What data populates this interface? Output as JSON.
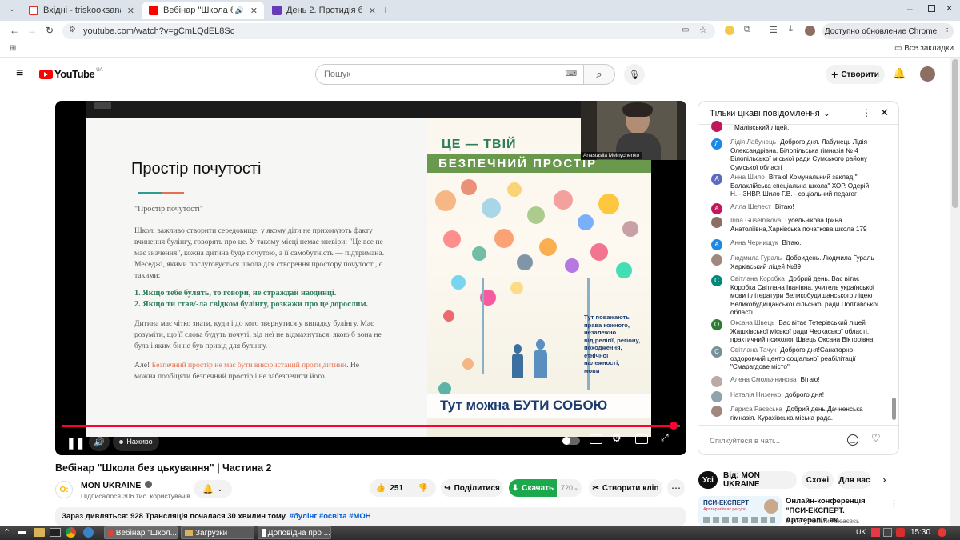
{
  "browser": {
    "tabs": [
      {
        "title": "Вхідні - triskooksana@g",
        "color": "#d93025"
      },
      {
        "title": "Вебінар \"Школа без ц",
        "color": "#ff0000"
      },
      {
        "title": "День 2. Протидія булінг",
        "color": "#673ab7"
      }
    ],
    "url": "youtube.com/watch?v=gCmLQdEL8Sc",
    "update_label": "Доступно обновление Chrome",
    "bookmarks_all": "Все закладки",
    "new_tab": "+"
  },
  "youtube": {
    "logo_text": "YouTube",
    "region": "UA",
    "search_placeholder": "Пошук",
    "create_label": "Створити"
  },
  "slide": {
    "title": "Простір почутості",
    "quote": "\"Простір почутості\"",
    "para1_l1": "Школі важливо створити середовище, у якому діти не приховують факту",
    "para1_l2": "вчинення булінгу, говорять про це. У такому місці немає зневіри: \"Це все не",
    "para1_l3": "має значення\", кожна дитина буде почутою, а її самобутність — підтримана.",
    "para1_l4": "Меседжі, якими послуговується школа для створення простору почутості, є",
    "para1_l5": "такими:",
    "point1": "1. Якщо тебе булять, то говори, не страждай наодинці.",
    "point2": "2. Якщо ти став/-ла свідком булінгу, розкажи про це дорослим.",
    "para2_l1": "Дитина має чітко знати, куди і до кого звернутися у випадку булінгу. Має",
    "para2_l2": "розуміти, що її слова будуть почуті, від неї не відмахнуться, якою б вона не",
    "para2_l3": "була і яким би не був привід для булінгу.",
    "para3_pre": "Але! ",
    "para3_hl": "Безпечний простір не має бути використаний проти дитини",
    "para3_post": ". Не",
    "para3_l2": "можна пообіцяти безпечний простір і не забезпечити його."
  },
  "poster": {
    "line1": "ЦЕ — ТВІЙ",
    "line2": "БЕЗПЕЧНИЙ ПРОСТІР",
    "side_text_l1": "Тут поважають",
    "side_text_l2": "права кожного,",
    "side_text_l3": "незалежно",
    "side_text_l4": "від релігії, регіону,",
    "side_text_l5": "походження,",
    "side_text_l6": "етнічної",
    "side_text_l7": "належності,",
    "side_text_l8": "мови",
    "bottom": "Тут можна БУТИ СОБОЮ"
  },
  "webcam_name": "Anastasiia Melnychenko",
  "player": {
    "live_label": "Наживо",
    "progress": 0.99,
    "progress_color": "#ff0033"
  },
  "video": {
    "title": "Вебінар \"Школа без цькування\" | Частина 2",
    "channel": "MON UKRAINE",
    "subs": "Підписалося 306 тис. користувачів",
    "likes": "251",
    "share": "Поділитися",
    "download": "Скачать",
    "quality": "720",
    "clip": "Створити кліп",
    "description_line": "Зараз дивляться: 928  Трансляція почалася 30 хвилин тому",
    "tags": "#булінг #освіта #МОН"
  },
  "chat": {
    "header": "Тільки цікаві повідомлення",
    "input_placeholder": "Спілкуйтеся в чаті...",
    "messages": [
      {
        "author": "",
        "text": "Малівський ліцей.",
        "initial": "",
        "color": "#c2185b"
      },
      {
        "author": "Лідія Лабунець",
        "text": "Доброго дня. Лабунець Лідія Олександрівна. Білопільська гімназія № 4 Білопільської міської ради Сумського району Сумської області",
        "initial": "Л",
        "color": "#1e88e5"
      },
      {
        "author": "Анна Шило",
        "text": "Вітаю! Комунальний заклад \" Балаклійська спеціальна школа\" ХОР. Одерій Н.І- ЗНВР. Шило Г.В. - соціальний педагог",
        "initial": "А",
        "color": "#5c6bc0"
      },
      {
        "author": "Алла Шелест",
        "text": "Вітаю!",
        "initial": "А",
        "color": "#c2185b"
      },
      {
        "author": "Irina Guselnikova",
        "text": "Гусельнікова Ірина Анатоліївна,Харківська початкова школа 179",
        "initial": "",
        "color": "#8d6e63"
      },
      {
        "author": "Анна Чернищук",
        "text": "Вітаю.",
        "initial": "А",
        "color": "#1e88e5"
      },
      {
        "author": "Людмила Гураль",
        "text": "Добридень. Людмила Гураль Харківський ліцей №89",
        "initial": "",
        "color": "#a1887f"
      },
      {
        "author": "Світлана Коробка",
        "text": "Добрий день. Вас вітає Коробка Світлана Іванівна, учитель української мови і літератури Великобудищанського ліцею Великобудищанської сільської ради Полтавської області.",
        "initial": "С",
        "color": "#00897b"
      },
      {
        "author": "Оксана Швець",
        "text": "Вас вітає Тетерівський ліцей Жашківської міської ради Черкаської області, практичний психолог Швець Оксана Вікторівна",
        "initial": "О",
        "color": "#2e7d32"
      },
      {
        "author": "Світлана Тачук",
        "text": "Доброго дня!Санаторно-оздоровчий центр соціальної реабілітації \"Смарагдове місто\"",
        "initial": "С",
        "color": "#78909c"
      },
      {
        "author": "Алена Смольянинова",
        "text": "Вітаю!",
        "initial": "",
        "color": "#bcaaa4"
      },
      {
        "author": "Наталія Низенко",
        "text": "доброго дня!",
        "initial": "",
        "color": "#90a4ae"
      },
      {
        "author": "Лариса Раєвська",
        "text": "Добрий день.Дачненська гімназія. Курахівська міська рада.",
        "initial": "",
        "color": "#a1887f"
      }
    ]
  },
  "filters": [
    "Усі",
    "Від: MON UKRAINE",
    "Схожі",
    "Для вас"
  ],
  "recommendation": {
    "title": "Онлайн-конференція \"ПСИ-ЕКСПЕРТ. Арттерапія як ...",
    "channel": "Інститут Ольги Гоюаєвєь",
    "thumb_title": "ПСИ-ЕКСПЕРТ",
    "thumb_sub": "Арттерапія як ресурс"
  },
  "taskbar": {
    "tasks": [
      "Вебінар \"Школ...",
      "Загрузки",
      "Доповідна про ..."
    ],
    "lang": "UK",
    "time": "15:30"
  }
}
